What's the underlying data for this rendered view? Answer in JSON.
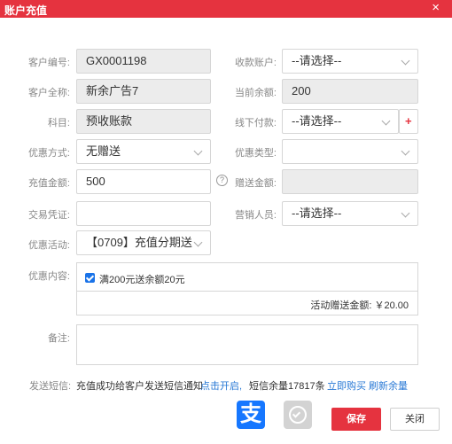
{
  "dialog": {
    "title": "账户充值",
    "close_glyph": "×"
  },
  "form": {
    "customer_id": {
      "label": "客户编号:",
      "value": "GX0001198"
    },
    "receiving_account": {
      "label": "收款账户:",
      "value": "--请选择--"
    },
    "customer_name": {
      "label": "客户全称:",
      "value": "新余广告7"
    },
    "current_balance": {
      "label": "当前余额:",
      "value": "200"
    },
    "subject": {
      "label": "科目:",
      "value": "预收账款"
    },
    "offline_payment": {
      "label": "线下付款:",
      "value": "--请选择--",
      "add_glyph": "+"
    },
    "discount_method": {
      "label": "优惠方式:",
      "value": "无赠送"
    },
    "discount_type": {
      "label": "优惠类型:",
      "value": ""
    },
    "recharge_amount": {
      "label": "充值金额:",
      "value": "500",
      "help_glyph": "?"
    },
    "gift_amount": {
      "label": "赠送金额:",
      "value": ""
    },
    "voucher": {
      "label": "交易凭证:",
      "value": ""
    },
    "sales_person": {
      "label": "营销人员:",
      "value": "--请选择--"
    },
    "promotion": {
      "label": "优惠活动:",
      "value": "【0709】充值分期送"
    },
    "promo_content": {
      "label": "优惠内容:",
      "checkbox_label": "满200元送余额20元",
      "checked": true,
      "total_text": "活动赠送金额: ￥20.00"
    },
    "memo": {
      "label": "备注:",
      "value": ""
    }
  },
  "sms": {
    "label": "发送短信:",
    "text": "充值成功给客户发送短信通知",
    "enable_link": "点击开启,",
    "balance_text": "短信余量17817条",
    "buy_link": "立即购买",
    "refresh_link": "刷新余量"
  },
  "payment_icons": {
    "alipay": "alipay-icon",
    "alipay_glyph": "支",
    "wechat": "wechat-pay-icon"
  },
  "buttons": {
    "save": "保存",
    "close": "关闭"
  },
  "colors": {
    "accent": "#e5333f",
    "link": "#2a7ad6",
    "alipay": "#1677ff",
    "checkbox": "#1a73e8"
  }
}
